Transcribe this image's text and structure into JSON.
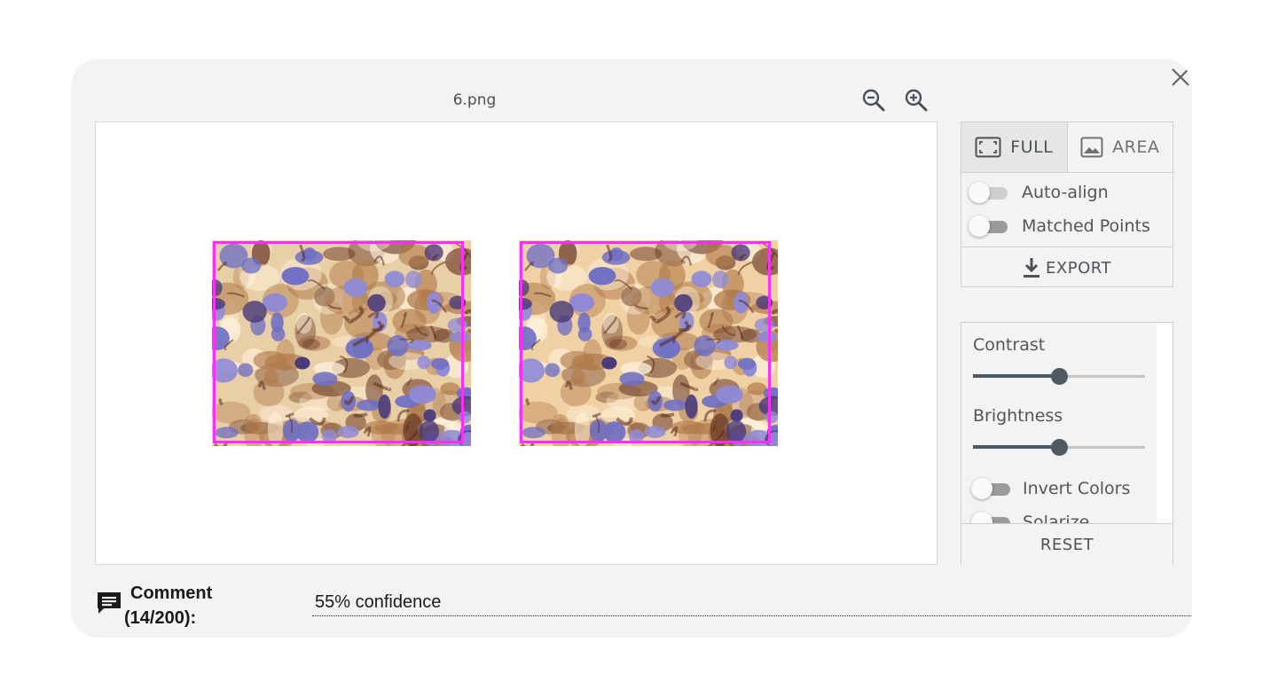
{
  "dialog": {
    "title": "6.png",
    "close_icon": "close-icon",
    "zoom_out_icon": "zoom-out-icon",
    "zoom_in_icon": "zoom-in-icon"
  },
  "viewer": {
    "images": [
      {
        "name": "left-image",
        "content": "stained cell tissue micrograph"
      },
      {
        "name": "right-image",
        "content": "stained cell tissue micrograph"
      }
    ],
    "highlight_color": "#ff2dff"
  },
  "mode_panel": {
    "tabs": [
      {
        "label": "FULL",
        "icon": "fit-screen-icon",
        "active": true
      },
      {
        "label": "AREA",
        "icon": "image-icon",
        "active": false
      }
    ],
    "toggles": [
      {
        "label": "Auto-align",
        "on": false
      },
      {
        "label": "Matched Points",
        "on": false
      }
    ],
    "export_label": "EXPORT",
    "export_icon": "download-icon"
  },
  "adjust_panel": {
    "sliders": [
      {
        "label": "Contrast",
        "value": 0.5
      },
      {
        "label": "Brightness",
        "value": 0.5
      }
    ],
    "toggles": [
      {
        "label": "Invert Colors",
        "on": false
      },
      {
        "label": "Solarize",
        "on": false
      }
    ],
    "reset_label": "RESET"
  },
  "comment": {
    "label_line1": "Comment",
    "label_line2": "(14/200):",
    "value": "55% confidence",
    "icon": "comment-icon"
  },
  "colors": {
    "dialog_bg": "#f3f3f3",
    "accent_dark": "#4f5962"
  }
}
